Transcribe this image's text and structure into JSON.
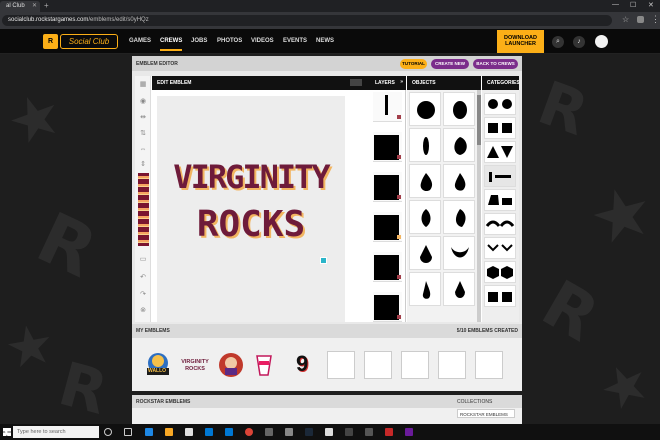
{
  "browser": {
    "tab_title": "al Club",
    "url_host": "socialclub.rockstargames.com",
    "url_path": "/emblems/edit/s0yHQz"
  },
  "nav": {
    "logo_rs": "R",
    "logo_sc": "Social Club",
    "items": [
      "GAMES",
      "CREWS",
      "JOBS",
      "PHOTOS",
      "VIDEOS",
      "EVENTS",
      "NEWS"
    ],
    "download_line1": "DOWNLOAD",
    "download_line2": "LAUNCHER"
  },
  "editor": {
    "title": "EMBLEM EDITOR",
    "tutorial": "TUTORIAL",
    "create_new": "CREATE NEW",
    "back_to_crews": "BACK TO CREWS",
    "canvas_title": "EDIT EMBLEM",
    "layers_title": "LAYERS",
    "layers_collapse": "»",
    "objects_title": "OBJECTS",
    "categories_title": "CATEGORIES",
    "emblem_line1": "VIRGINITY",
    "emblem_line2": "ROCKS"
  },
  "my_emblems": {
    "title": "MY EMBLEMS",
    "count": "5/10 EMBLEMS CREATED",
    "thumb2_line1": "VIRGINITY",
    "thumb2_line2": "ROCKS",
    "thumb1_text": "WALLO",
    "thumb5_text": "9"
  },
  "rockstar_emblems": {
    "title": "ROCKSTAR EMBLEMS",
    "collections": "COLLECTIONS",
    "collection_item": "ROCKSTAR EMBLEMS"
  },
  "taskbar": {
    "search": "Type here to search"
  },
  "colors": {
    "accent": "#fcaf17",
    "purple": "#7b2d8b",
    "emblem_fill": "#6e1b3a",
    "emblem_shadow": "#f2b561"
  }
}
